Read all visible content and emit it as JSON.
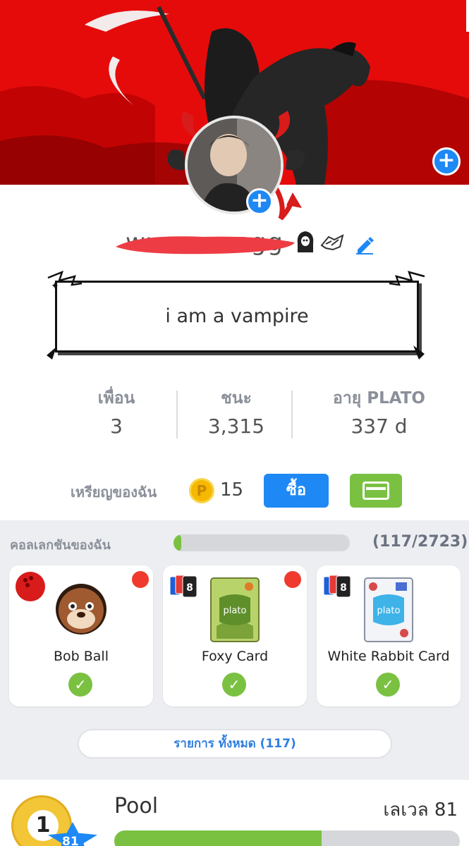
{
  "profile": {
    "username": "wwwsaxngg",
    "bio": "i am a vampire"
  },
  "stats": [
    {
      "label": "เพื่อน",
      "value": "3"
    },
    {
      "label": "ชนะ",
      "value": "3,315"
    },
    {
      "label": "อายุ PLATO",
      "value": "337 d"
    }
  ],
  "coins": {
    "label": "เหรียญของฉัน",
    "coin_glyph": "P",
    "count": "15",
    "buy_label": "ซื้อ"
  },
  "collection": {
    "title": "คอลเลกชันของฉัน",
    "count": "(117/2723)",
    "progress": 0.043,
    "items": [
      {
        "name": "Bob Ball"
      },
      {
        "name": "Foxy Card"
      },
      {
        "name": "White Rabbit Card"
      }
    ],
    "card_logo": "plato",
    "all_label": "รายการ ทั้งหมด (117)"
  },
  "game": {
    "name": "Pool",
    "ball_number": "1",
    "badge": "81",
    "level_label": "เลเวล 81",
    "progress": 0.6
  },
  "colors": {
    "accent_blue": "#1e88f5",
    "accent_green": "#7ac142",
    "cover_red": "#e50b0b"
  }
}
